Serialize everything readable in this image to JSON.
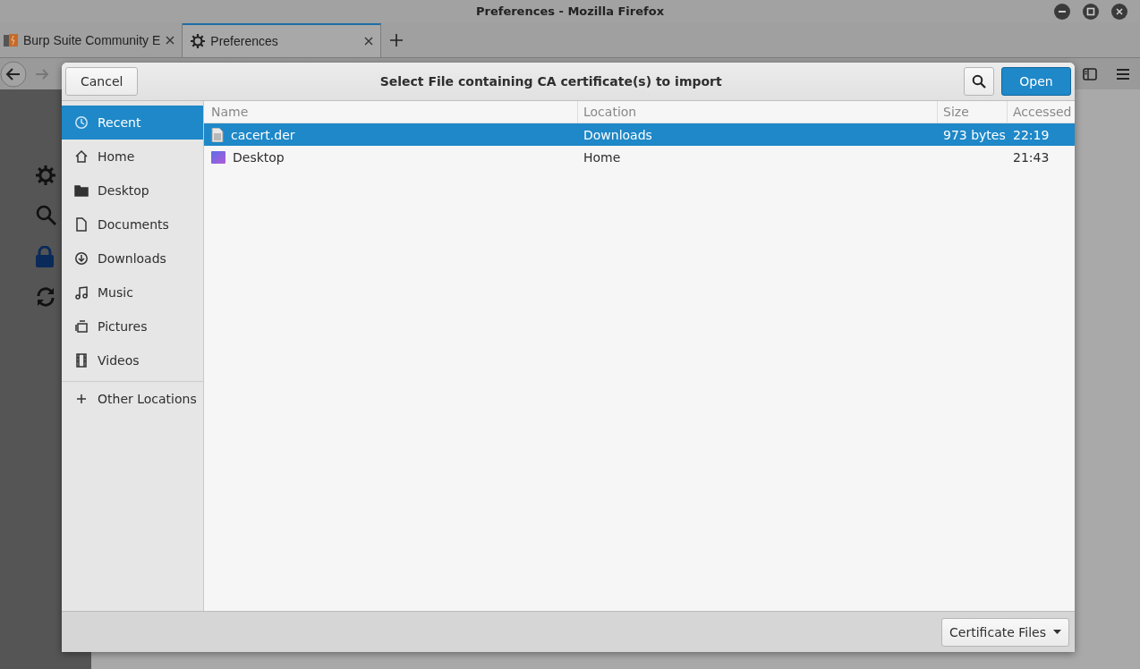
{
  "window": {
    "title": "Preferences - Mozilla Firefox"
  },
  "tabs": [
    {
      "label": "Burp Suite Community E",
      "kind": "burp",
      "selected": false
    },
    {
      "label": "Preferences",
      "kind": "gear",
      "selected": true
    }
  ],
  "dialog": {
    "title": "Select File containing CA certificate(s) to import",
    "cancel": "Cancel",
    "open": "Open",
    "places": [
      {
        "label": "Recent",
        "kind": "recent",
        "selected": true
      },
      {
        "label": "Home",
        "kind": "home",
        "selected": false
      },
      {
        "label": "Desktop",
        "kind": "folder",
        "selected": false
      },
      {
        "label": "Documents",
        "kind": "document",
        "selected": false
      },
      {
        "label": "Downloads",
        "kind": "download",
        "selected": false
      },
      {
        "label": "Music",
        "kind": "music",
        "selected": false
      },
      {
        "label": "Pictures",
        "kind": "pictures",
        "selected": false
      },
      {
        "label": "Videos",
        "kind": "videos",
        "selected": false
      }
    ],
    "other_locations": "Other Locations",
    "columns": [
      "Name",
      "Location",
      "Size",
      "Accessed"
    ],
    "files": [
      {
        "name": "cacert.der",
        "location": "Downloads",
        "size": "973 bytes",
        "accessed": "22:19",
        "kind": "file",
        "selected": true
      },
      {
        "name": "Desktop",
        "location": "Home",
        "accessed": "21:43",
        "kind": "desktop",
        "selected": false
      }
    ],
    "filter": "Certificate Files"
  }
}
